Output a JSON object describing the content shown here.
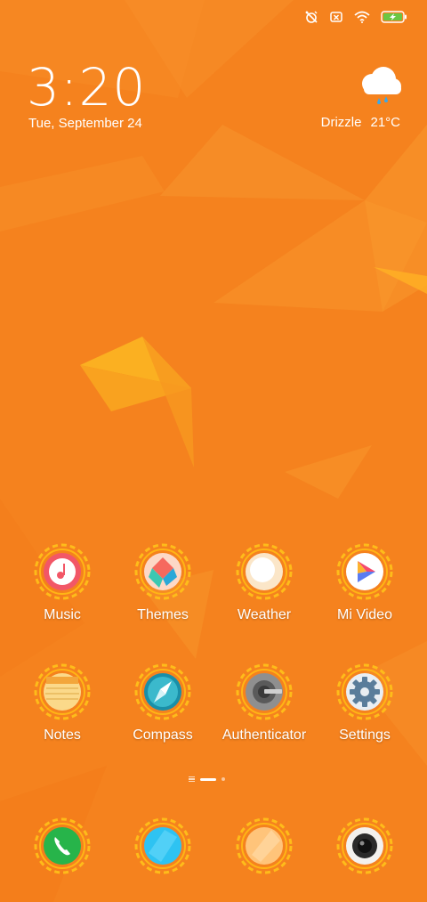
{
  "status_bar": {
    "icons": [
      "alarm-off-icon",
      "no-sim-icon",
      "wifi-icon",
      "battery-charging-icon"
    ],
    "battery_color": "#6cc644"
  },
  "clock_widget": {
    "time": "3:20",
    "date": "Tue, September 24"
  },
  "weather_widget": {
    "icon": "cloud-drizzle-icon",
    "condition": "Drizzle",
    "temperature": "21°C"
  },
  "apps": [
    {
      "label": "Music",
      "icon": "music-icon"
    },
    {
      "label": "Themes",
      "icon": "themes-icon"
    },
    {
      "label": "Weather",
      "icon": "weather-icon"
    },
    {
      "label": "Mi Video",
      "icon": "mi-video-icon"
    },
    {
      "label": "Notes",
      "icon": "notes-icon"
    },
    {
      "label": "Compass",
      "icon": "compass-icon"
    },
    {
      "label": "Authenticator",
      "icon": "authenticator-icon"
    },
    {
      "label": "Settings",
      "icon": "settings-icon"
    }
  ],
  "page_indicator": {
    "pages": 2,
    "current": 1
  },
  "dock": [
    {
      "icon": "phone-icon"
    },
    {
      "icon": "messaging-icon"
    },
    {
      "icon": "browser-icon"
    },
    {
      "icon": "camera-icon"
    }
  ],
  "colors": {
    "wallpaper": "#f5821e",
    "ring": "#ffc21a",
    "text": "#ffffff"
  }
}
